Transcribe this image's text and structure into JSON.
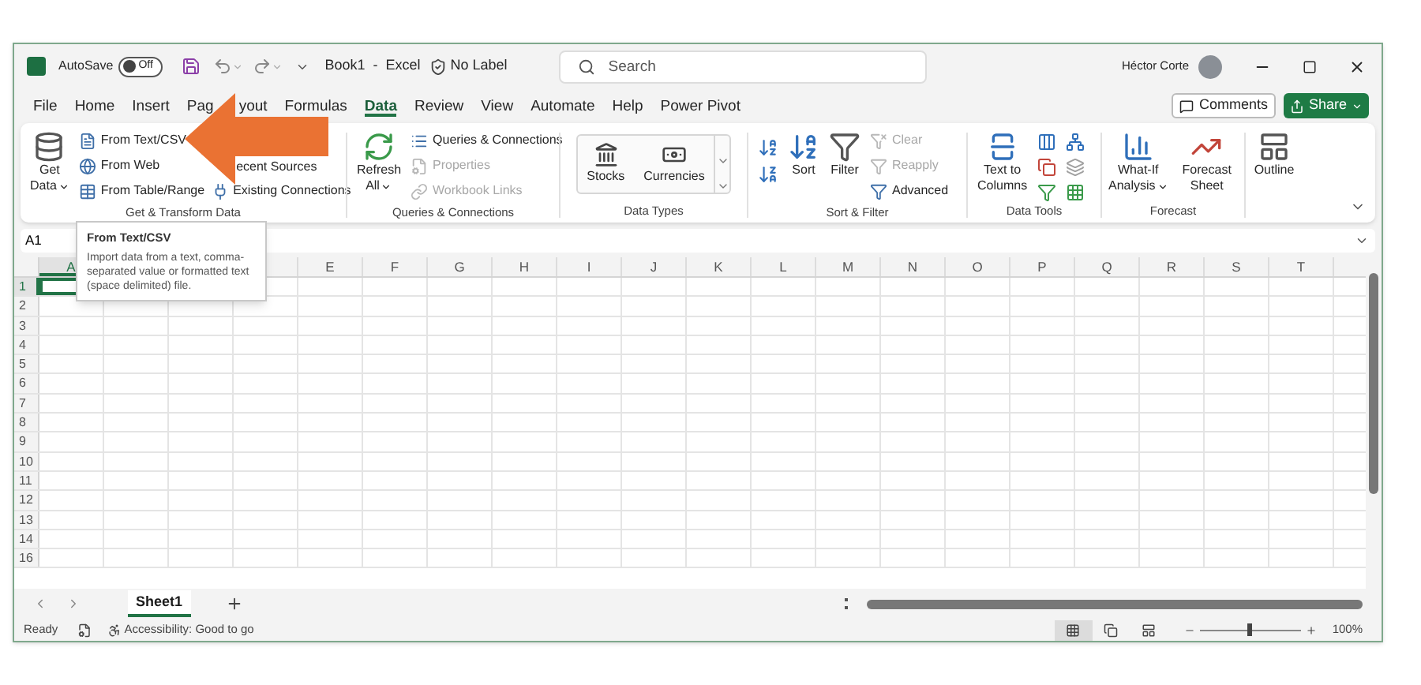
{
  "title_bar": {
    "autosave_label": "AutoSave",
    "autosave": {
      "on": false,
      "label": "Off"
    },
    "document_title": "Book1  -  Excel",
    "sensitivity": "No Label",
    "search": {
      "placeholder": "Search"
    },
    "user_name": "Héctor Corte"
  },
  "tabs": [
    {
      "label": "File",
      "selected": false
    },
    {
      "label": "Home",
      "selected": false
    },
    {
      "label": "Insert",
      "selected": false
    },
    {
      "label": "Pag",
      "label_end": "yout",
      "selected": false
    },
    {
      "label": "Formulas",
      "selected": false
    },
    {
      "label": "Data",
      "selected": true
    },
    {
      "label": "Review",
      "selected": false
    },
    {
      "label": "View",
      "selected": false
    },
    {
      "label": "Automate",
      "selected": false
    },
    {
      "label": "Help",
      "selected": false
    },
    {
      "label": "Power Pivot",
      "selected": false
    }
  ],
  "header_buttons": {
    "comments": "Comments",
    "share": "Share"
  },
  "groups": [
    {
      "kind": "get",
      "label": "Get & Transform Data",
      "large": [
        "Get",
        "Data"
      ],
      "items": [
        {
          "kind": "text",
          "label": "From Text/CSV",
          "disabled": false
        },
        {
          "kind": "web",
          "label": "From Web",
          "disabled": false
        },
        {
          "kind": "table",
          "label": "From Table/Range",
          "disabled": false
        }
      ],
      "side_items": [
        {
          "kind": "recent",
          "label": "ecent Sources",
          "disabled": false
        },
        {
          "kind": "existing",
          "label": "Existing Connections",
          "disabled": false
        }
      ]
    },
    {
      "kind": "queries",
      "label": "Queries & Connections",
      "large": [
        "Refresh",
        "All"
      ],
      "items": [
        {
          "kind": "queries",
          "label": "Queries & Connections",
          "disabled": false
        },
        {
          "kind": "properties",
          "label": "Properties",
          "disabled": true
        },
        {
          "kind": "links",
          "label": "Workbook Links",
          "disabled": true
        }
      ]
    },
    {
      "kind": "types",
      "label": "Data Types",
      "items": [
        {
          "kind": "stocks",
          "label": "Stocks"
        },
        {
          "kind": "currencies",
          "label": "Currencies"
        }
      ]
    },
    {
      "kind": "sort",
      "label": "Sort & Filter",
      "sort": "Sort",
      "filter": "Filter",
      "items": [
        {
          "kind": "clear",
          "label": "Clear",
          "disabled": true
        },
        {
          "kind": "reapply",
          "label": "Reapply",
          "disabled": true
        },
        {
          "kind": "advanced",
          "label": "Advanced",
          "disabled": false
        }
      ]
    },
    {
      "kind": "tools",
      "label": "Data Tools",
      "large": [
        "Text to",
        "Columns"
      ]
    },
    {
      "kind": "forecast",
      "label": "Forecast",
      "whatif": [
        "What-If",
        "Analysis"
      ],
      "sheet": [
        "Forecast",
        "Sheet"
      ]
    },
    {
      "kind": "outline",
      "large": [
        "Outline"
      ]
    }
  ],
  "name_box": "A1",
  "tooltip": {
    "title": "From Text/CSV",
    "body": "Import data from a text, comma-separated value or formatted text (space delimited) file."
  },
  "columns": [
    {
      "label": "A",
      "selected": true
    },
    {
      "label": "E",
      "selected": false
    },
    {
      "label": "F",
      "selected": false
    },
    {
      "label": "G",
      "selected": false
    },
    {
      "label": "H",
      "selected": false
    },
    {
      "label": "I",
      "selected": false
    },
    {
      "label": "J",
      "selected": false
    },
    {
      "label": "K",
      "selected": false
    },
    {
      "label": "L",
      "selected": false
    },
    {
      "label": "M",
      "selected": false
    },
    {
      "label": "N",
      "selected": false
    },
    {
      "label": "O",
      "selected": false
    },
    {
      "label": "P",
      "selected": false
    },
    {
      "label": "Q",
      "selected": false
    },
    {
      "label": "R",
      "selected": false
    },
    {
      "label": "S",
      "selected": false
    },
    {
      "label": "T",
      "selected": false
    }
  ],
  "rows": [
    {
      "label": "1",
      "selected": true
    },
    {
      "label": "2",
      "selected": false
    },
    {
      "label": "3",
      "selected": false
    },
    {
      "label": "4",
      "selected": false
    },
    {
      "label": "5",
      "selected": false
    },
    {
      "label": "6",
      "selected": false
    },
    {
      "label": "7",
      "selected": false
    },
    {
      "label": "8",
      "selected": false
    },
    {
      "label": "9",
      "selected": false
    },
    {
      "label": "10",
      "selected": false
    },
    {
      "label": "11",
      "selected": false
    },
    {
      "label": "12",
      "selected": false
    },
    {
      "label": "13",
      "selected": false
    },
    {
      "label": "14",
      "selected": false
    },
    {
      "label": "16",
      "selected": false
    }
  ],
  "sheet_tabs": [
    {
      "label": "Sheet1",
      "selected": true
    }
  ],
  "status_bar": {
    "ready": "Ready",
    "accessibility": "Accessibility: Good to go",
    "views": [
      {
        "kind": "normal",
        "selected": true
      },
      {
        "kind": "layout",
        "selected": false
      },
      {
        "kind": "break",
        "selected": false
      }
    ],
    "zoom": {
      "level": 0.5,
      "reading": "100%"
    }
  }
}
